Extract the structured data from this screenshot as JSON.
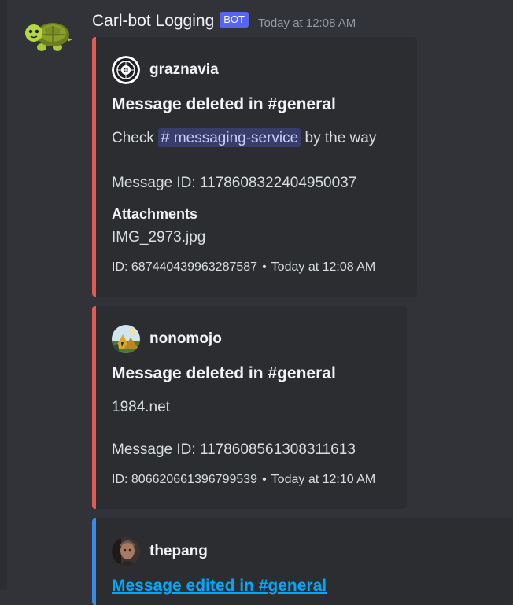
{
  "message": {
    "bot": {
      "username": "Carl-bot Logging",
      "tag": "BOT",
      "timestamp": "Today at 12:08 AM",
      "avatar_icon": "turtle-icon"
    },
    "embeds": [
      {
        "type": "delete",
        "accent_color": "#e05b56",
        "author": "graznavia",
        "author_avatar_icon": "emblem-avatar-icon",
        "title": "Message deleted in #general",
        "content_before": "Check",
        "channel_mention": "messaging-service",
        "content_after": "by the way",
        "message_id": "Message ID: 1178608322404950037",
        "field_name": "Attachments",
        "field_value": "IMG_2973.jpg",
        "footer_id": "ID: 687440439963287587",
        "footer_separator": "•",
        "footer_time": "Today at 12:08 AM"
      },
      {
        "type": "delete",
        "accent_color": "#e05b56",
        "author": "nonomojo",
        "author_avatar_icon": "landscape-avatar-icon",
        "title": "Message deleted in #general",
        "content": "1984.net",
        "message_id": "Message ID: 1178608561308311613",
        "footer_id": "ID: 806620661396799539",
        "footer_separator": "•",
        "footer_time": "Today at 12:10 AM"
      },
      {
        "type": "edit",
        "accent_color": "#3a8ae6",
        "author": "thepang",
        "author_avatar_icon": "person-avatar-icon",
        "title": "Message edited in #general"
      }
    ]
  }
}
